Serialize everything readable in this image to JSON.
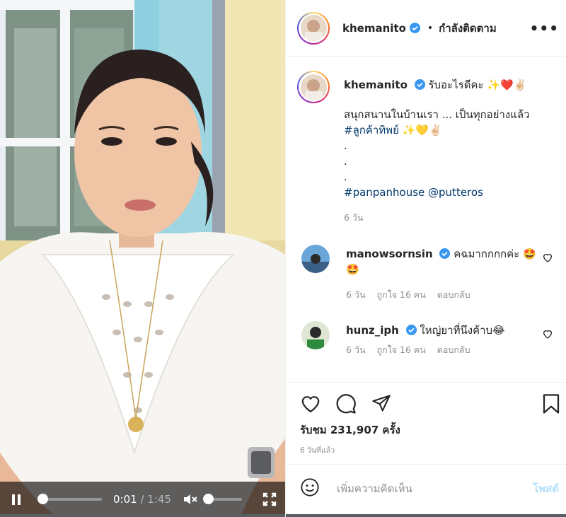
{
  "post": {
    "username": "khemanito",
    "follow_status": "กำลังติดตาม",
    "more_label": "•••"
  },
  "caption": {
    "username": "khemanito",
    "line1": "รับอะไรดีคะ ✨❤️✌🏻",
    "line2": "สนุกสนานในบ้านเรา ... เป็นทุกอย่างแล้ว",
    "hashtag1": "#ลูกค้าทิพย์",
    "hashtag1_emoji": "✨💛✌🏻",
    "dots": [
      ".",
      ".",
      "."
    ],
    "hashtag2": "#panpanhouse",
    "mention": "@putteros",
    "time": "6 วัน"
  },
  "comments": [
    {
      "username": "manowsornsin",
      "text": "คฉมากกกกค่ะ 🤩🤩",
      "time": "6 วัน",
      "likes": "ถูกใจ 16 คน",
      "reply": "ตอบกลับ"
    },
    {
      "username": "hunz_iph",
      "text": "ใหญ่ยาที่นึงค้าบ😂",
      "time": "6 วัน",
      "likes": "ถูกใจ 16 คน",
      "reply": "ตอบกลับ"
    }
  ],
  "stats": {
    "views": "รับชม 231,907 ครั้ง",
    "date": "6 วันที่แล้ว"
  },
  "add_comment": {
    "placeholder": "เพิ่มความคิดเห็น",
    "post_label": "โพสต์"
  },
  "video": {
    "current_time": "0:01",
    "separator": " / ",
    "duration": "1:45",
    "progress_fraction": 0.01
  },
  "icons": [
    "pause-icon",
    "volume-muted-icon",
    "fullscreen-icon",
    "heart-icon",
    "comment-icon",
    "share-icon",
    "bookmark-icon",
    "emoji-icon",
    "verified-icon"
  ],
  "colors": {
    "link": "#00376b",
    "verified": "#3897f0",
    "muted": "#8e8e8e",
    "post_button": "#b2dffc"
  }
}
